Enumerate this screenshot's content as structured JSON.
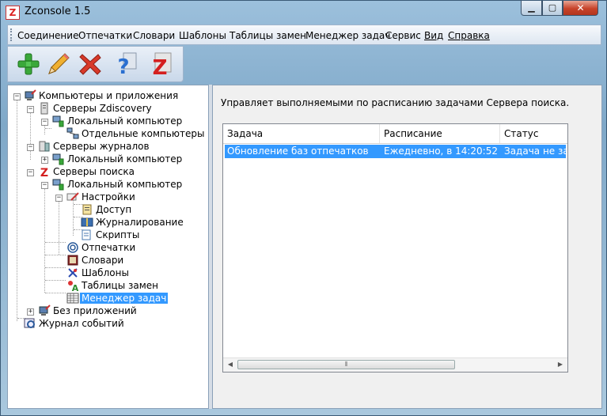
{
  "window": {
    "title": "Zconsole 1.5",
    "app_icon_glyph": "Z"
  },
  "menu": [
    {
      "label": "Соединение"
    },
    {
      "label": "Отпечатки"
    },
    {
      "label": "Словари"
    },
    {
      "label": "Шаблоны"
    },
    {
      "label": "Таблицы замен"
    },
    {
      "label": "Менеджер задач"
    },
    {
      "label": "Сервис"
    },
    {
      "label": "Вид"
    },
    {
      "label": "Справка"
    }
  ],
  "toolbar": [
    {
      "icon": "add-icon",
      "color": "#3aa83a"
    },
    {
      "icon": "edit-pencil-icon",
      "color": "#e8a020"
    },
    {
      "icon": "delete-icon",
      "color": "#d83a2a"
    },
    {
      "icon": "help-icon",
      "color": "#2a6fd0"
    },
    {
      "icon": "zconsole-icon",
      "color": "#d42020"
    }
  ],
  "tree": [
    {
      "label": "Компьютеры и приложения",
      "icon": "computer-apps-icon",
      "expander": "−"
    },
    {
      "label": "Серверы Zdiscovery",
      "icon": "server-icon",
      "expander": "−"
    },
    {
      "label": "Локальный компьютер",
      "icon": "local-computer-icon",
      "expander": "−"
    },
    {
      "label": "Отдельные компьютеры",
      "icon": "network-computers-icon",
      "expander": ""
    },
    {
      "label": "Серверы журналов",
      "icon": "log-server-icon",
      "expander": "−"
    },
    {
      "label": "Локальный компьютер",
      "icon": "local-computer-icon",
      "expander": "+"
    },
    {
      "label": "Серверы поиска",
      "icon": "search-server-icon",
      "expander": "−"
    },
    {
      "label": "Локальный компьютер",
      "icon": "local-computer-icon",
      "expander": "−"
    },
    {
      "label": "Настройки",
      "icon": "settings-icon",
      "expander": "−"
    },
    {
      "label": "Доступ",
      "icon": "access-icon",
      "expander": ""
    },
    {
      "label": "Журналирование",
      "icon": "logging-icon",
      "expander": ""
    },
    {
      "label": "Скрипты",
      "icon": "scripts-icon",
      "expander": ""
    },
    {
      "label": "Отпечатки",
      "icon": "fingerprint-icon",
      "expander": ""
    },
    {
      "label": "Словари",
      "icon": "dictionary-icon",
      "expander": ""
    },
    {
      "label": "Шаблоны",
      "icon": "templates-icon",
      "expander": ""
    },
    {
      "label": "Таблицы замен",
      "icon": "replace-table-icon",
      "expander": ""
    },
    {
      "label": "Менеджер задач",
      "icon": "task-manager-icon",
      "expander": "",
      "selected": true
    },
    {
      "label": "Без приложений",
      "icon": "no-apps-icon",
      "expander": "+"
    },
    {
      "label": "Журнал событий",
      "icon": "event-log-icon",
      "expander": ""
    }
  ],
  "panel": {
    "description": "Управляет выполняемыми по расписанию задачами Сервера поиска.",
    "columns": [
      "Задача",
      "Расписание",
      "Статус"
    ],
    "rows": [
      {
        "task": "Обновление баз отпечатков",
        "schedule": "Ежедневно, в 14:20:52",
        "status": "Задача не зап..."
      }
    ]
  }
}
